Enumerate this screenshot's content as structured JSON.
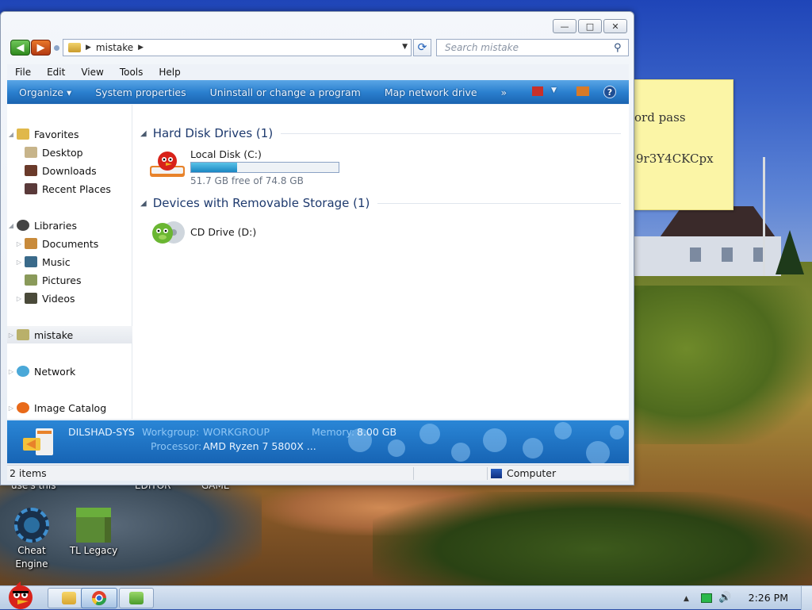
{
  "window": {
    "address_segment": "mistake",
    "search_placeholder": "Search mistake",
    "caption": {
      "minimize": "—",
      "maximize": "□",
      "close": "✕"
    }
  },
  "menu": [
    "File",
    "Edit",
    "View",
    "Tools",
    "Help"
  ],
  "toolbar": {
    "organize": "Organize",
    "items": [
      "System properties",
      "Uninstall or change a program",
      "Map network drive"
    ],
    "overflow": "»",
    "help": "?"
  },
  "nav": {
    "favorites": "Favorites",
    "desktop": "Desktop",
    "downloads": "Downloads",
    "recent_places": "Recent Places",
    "libraries": "Libraries",
    "documents": "Documents",
    "music": "Music",
    "pictures": "Pictures",
    "videos": "Videos",
    "homegroup_user": "mistake",
    "network": "Network",
    "image_catalog": "Image Catalog"
  },
  "groups": {
    "hdd": "Hard Disk Drives (1)",
    "removable": "Devices with Removable Storage (1)"
  },
  "drives": {
    "c": {
      "name": "Local Disk (C:)",
      "free_text": "51.7 GB free of 74.8 GB",
      "used_fraction": 0.31
    },
    "d": {
      "name": "CD Drive (D:)"
    }
  },
  "details": {
    "computer_name": "DILSHAD-SYS",
    "workgroup_label": "Workgroup:",
    "workgroup_value": "WORKGROUP",
    "memory_label": "Memory:",
    "memory_value": "8.00 GB",
    "processor_label": "Processor:",
    "processor_value": "AMD Ryzen 7 5800X ..."
  },
  "status": {
    "count": "2 items",
    "location": "Computer"
  },
  "sticky": {
    "line1": "ord pass",
    "line2": "9r3Y4CKCpx"
  },
  "desktop": {
    "icons": [
      {
        "label": "Cheat Engine"
      },
      {
        "label": "TL Legacy"
      }
    ],
    "partial_labels": [
      "use's this",
      "EDITOR",
      "GAME"
    ]
  },
  "taskbar": {
    "clock": "2:26 PM"
  },
  "colors": {
    "command_bar": "#2b80cf",
    "details_pane": "#1764b4",
    "progress_fill": "#1a86c2"
  }
}
